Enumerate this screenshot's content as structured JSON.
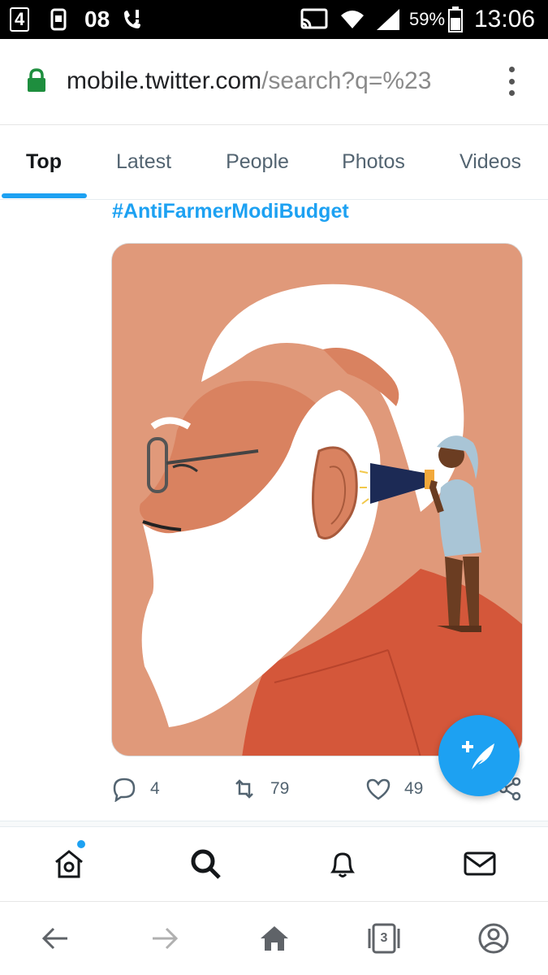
{
  "status_bar": {
    "network_badge": "4",
    "notification_count": "08",
    "battery_percent": "59%",
    "time": "13:06"
  },
  "browser": {
    "url_host": "mobile.twitter.com",
    "url_path": "/search?q=%23",
    "tab_count": "3"
  },
  "tabs": [
    {
      "label": "Top",
      "active": true
    },
    {
      "label": "Latest",
      "active": false
    },
    {
      "label": "People",
      "active": false
    },
    {
      "label": "Photos",
      "active": false
    },
    {
      "label": "Videos",
      "active": false
    }
  ],
  "tweet": {
    "hashtag": "#AntiFarmerModiBudget",
    "replies": "4",
    "retweets": "79",
    "likes": "49"
  },
  "icons": {
    "reply": "reply-icon",
    "retweet": "retweet-icon",
    "like": "heart-icon",
    "share": "share-icon",
    "compose": "compose-tweet-icon",
    "home": "home-icon",
    "search": "search-icon",
    "notifications": "bell-icon",
    "messages": "mail-icon"
  },
  "colors": {
    "accent": "#1da1f2",
    "illustration_background": "#e0997a",
    "shirt": "#d4573a"
  }
}
